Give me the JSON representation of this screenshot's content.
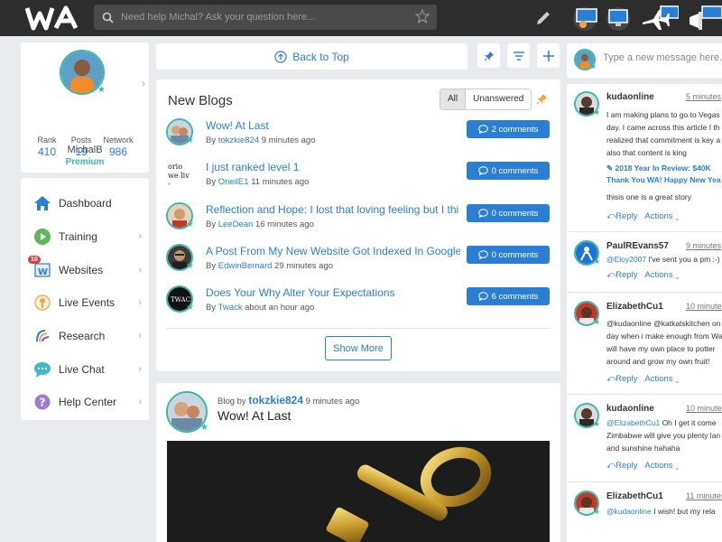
{
  "topbar": {
    "logo_text": "WA",
    "search_placeholder": "Need help Michal? Ask your question here...",
    "icons": [
      "pencil-icon",
      "classroom-icon",
      "monitor-icon",
      "plane-icon",
      "megaphone-icon"
    ]
  },
  "profile": {
    "name": "MichalB",
    "membership": "Premium",
    "stats": [
      {
        "label": "Rank",
        "value": "410"
      },
      {
        "label": "Posts",
        "value": "19"
      },
      {
        "label": "Network",
        "value": "986"
      }
    ]
  },
  "nav": {
    "items": [
      {
        "label": "Dashboard",
        "icon": "house-icon"
      },
      {
        "label": "Training",
        "icon": "play-icon"
      },
      {
        "label": "Websites",
        "icon": "websites-icon",
        "badge": "10"
      },
      {
        "label": "Live Events",
        "icon": "live-events-icon"
      },
      {
        "label": "Research",
        "icon": "research-icon"
      },
      {
        "label": "Live Chat",
        "icon": "chat-bubble-icon"
      },
      {
        "label": "Help Center",
        "icon": "question-icon"
      }
    ]
  },
  "main": {
    "back_to_top": "Back to Top",
    "blogs": {
      "title": "New Blogs",
      "filter_all": "All",
      "filter_unanswered": "Unanswered",
      "show_more": "Show More",
      "by_word": "By",
      "items": [
        {
          "title": "Wow! At Last",
          "author": "tokzkie824",
          "time": "9 minutes ago",
          "comments": "2 comments"
        },
        {
          "title": "I just ranked level 1",
          "author": "OneilE1",
          "time": "11 minutes ago",
          "comments": "0 comments"
        },
        {
          "title": "Reflection and Hope: I lost that loving feeling but I thi",
          "author": "LeeDean",
          "time": "16 minutes ago",
          "comments": "0 comments"
        },
        {
          "title": "A Post From My New Website Got Indexed In Google",
          "author": "EdwinBernard",
          "time": "29 minutes ago",
          "comments": "0 comments"
        },
        {
          "title": "Does Your Why Alter Your Expectations",
          "author": "Twack",
          "time": "about an hour ago",
          "comments": "6 comments"
        }
      ]
    },
    "post": {
      "by_label": "Blog by",
      "author": "tokzkie824",
      "time": "9 minutes ago",
      "title": "Wow! At Last"
    }
  },
  "chat": {
    "placeholder": "Type a new message here...",
    "reply_label": "Reply",
    "actions_label": "Actions",
    "messages": [
      {
        "name": "kudaonline",
        "time": "5 minutes",
        "lines": [
          "I am making plans to go to Vegas",
          "day. I came across this article I th",
          "realized that commitment is key a",
          "also that content is king"
        ],
        "link": [
          "2018 Year In Review: $40K",
          "Thank You WA! Happy New Yea"
        ],
        "extra": "thisis one is a great story"
      },
      {
        "name": "PaulREvans57",
        "time": "9 minutes",
        "mention": "@Eloy2007",
        "lines": [
          " I've sent you a pm :-)"
        ]
      },
      {
        "name": "ElizabethCu1",
        "time": "10 minutes",
        "lines": [
          "@kudaonline @katkatskitchen on",
          "day when i make enough from Wa",
          "will have my own place to potter",
          "around and grow my own fruit!"
        ]
      },
      {
        "name": "kudaonline",
        "time": "10 minutes",
        "mention": "@ElizabethCu1",
        "lines": [
          " Oh I get it come",
          "Zimbabwe will give you plenty lan",
          "and sunshine hahaha"
        ]
      },
      {
        "name": "ElizabethCu1",
        "time": "11 minutes",
        "mention": "@kudaonline",
        "lines": [
          " I wish! but my rela"
        ]
      }
    ]
  },
  "colors": {
    "accent": "#2a7fd4",
    "teal": "#3fb8a3",
    "topbar": "#2d2d2d",
    "background": "#e9ebee"
  }
}
